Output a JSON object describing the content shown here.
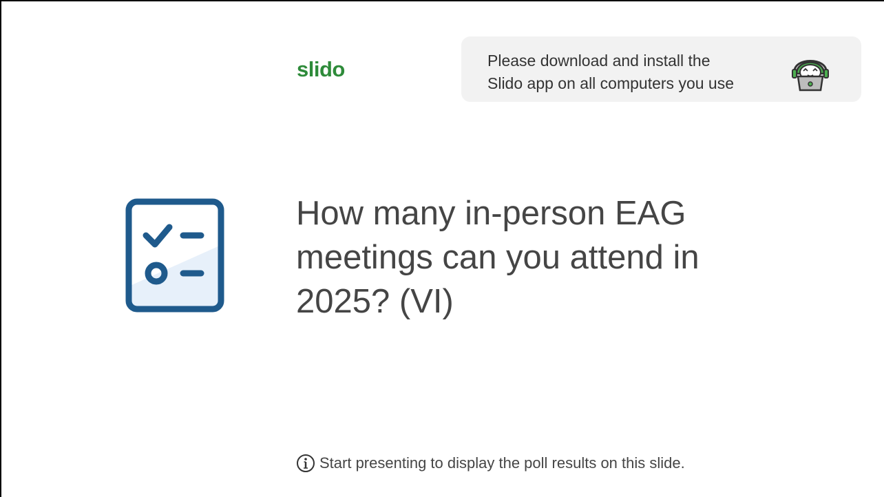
{
  "logo": {
    "text": "slido",
    "color": "#2e8b3a"
  },
  "banner": {
    "lines": [
      "Please download and install the",
      "Slido app on all computers you use"
    ],
    "background": "#f2f2f2",
    "mascot_icon": "laptop-mascot-icon"
  },
  "poll": {
    "icon": "poll-checklist-icon",
    "icon_color": "#1f5a8c",
    "question_lines": [
      "How many in-person EAG",
      "meetings can you attend in",
      "2025? (VI)"
    ]
  },
  "footer": {
    "info_icon": "info-icon",
    "hint": "Start presenting to display the poll results on this slide."
  }
}
